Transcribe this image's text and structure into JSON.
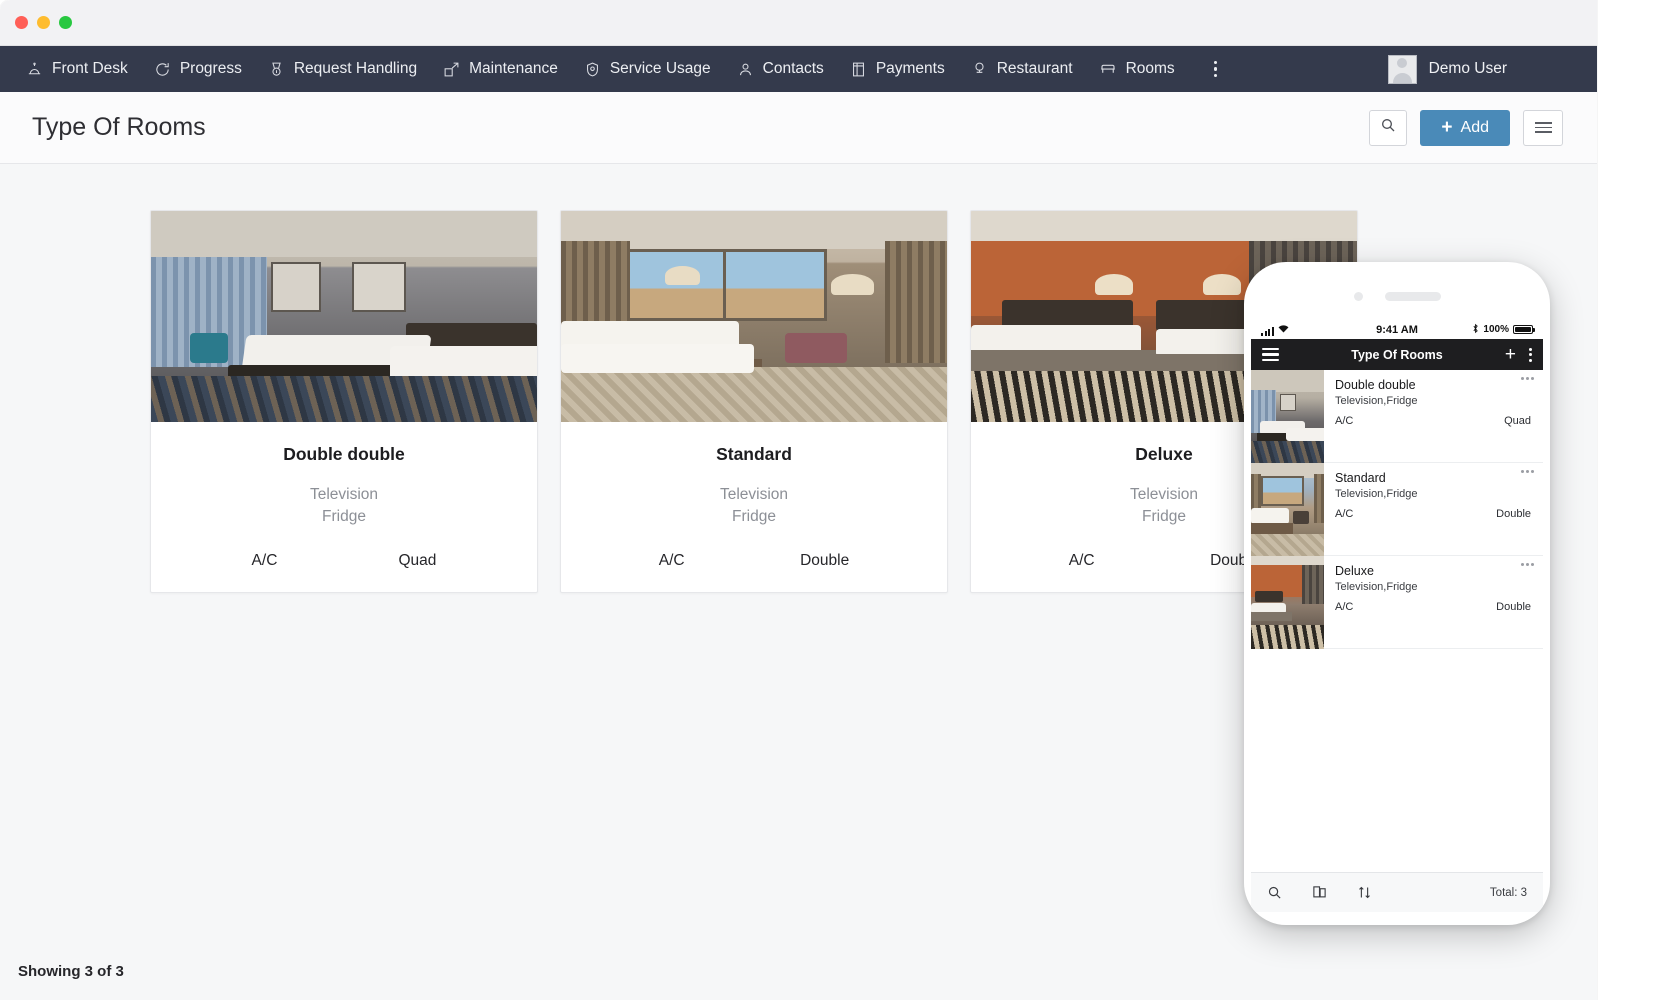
{
  "window": {
    "traffic_lights": [
      "close",
      "minimize",
      "maximize"
    ]
  },
  "navbar": {
    "items": [
      {
        "label": "Front Desk",
        "icon": "bell-icon"
      },
      {
        "label": "Progress",
        "icon": "refresh-icon"
      },
      {
        "label": "Request Handling",
        "icon": "medal-icon"
      },
      {
        "label": "Maintenance",
        "icon": "expand-arrow-icon"
      },
      {
        "label": "Service Usage",
        "icon": "shield-icon"
      },
      {
        "label": "Contacts",
        "icon": "person-icon"
      },
      {
        "label": "Payments",
        "icon": "card-icon"
      },
      {
        "label": "Restaurant",
        "icon": "chef-hat-icon"
      },
      {
        "label": "Rooms",
        "icon": "bed-icon"
      }
    ],
    "overflow_icon": "vertical-dots-icon",
    "user": {
      "name": "Demo User",
      "avatar": "user-avatar-icon"
    },
    "background": "#343a4c"
  },
  "header": {
    "title": "Type Of Rooms",
    "search_icon": "search-icon",
    "add_label": "Add",
    "add_icon": "plus-icon",
    "add_color": "#4a8ab8",
    "menu_icon": "list-view-icon"
  },
  "cards": [
    {
      "name": "Double double",
      "features": [
        "Television",
        "Fridge"
      ],
      "ac": "A/C",
      "occupancy": "Quad",
      "image": "hotel-room-double-double"
    },
    {
      "name": "Standard",
      "features": [
        "Television",
        "Fridge"
      ],
      "ac": "A/C",
      "occupancy": "Double",
      "image": "hotel-room-standard"
    },
    {
      "name": "Deluxe",
      "features": [
        "Television",
        "Fridge"
      ],
      "ac": "A/C",
      "occupancy": "Double",
      "image": "hotel-room-deluxe"
    }
  ],
  "footer": {
    "showing": "Showing 3 of 3"
  },
  "phone": {
    "status_bar": {
      "time": "9:41 AM",
      "signal_icon": "signal-bars-icon",
      "wifi_icon": "wifi-icon",
      "bluetooth_icon": "bluetooth-icon",
      "battery_percent": "100%",
      "battery_icon": "battery-full-icon"
    },
    "appbar": {
      "menu_icon": "hamburger-icon",
      "title": "Type Of Rooms",
      "add_icon": "plus-icon",
      "more_icon": "vertical-dots-icon"
    },
    "rows": [
      {
        "title": "Double double",
        "subtitle": "Television,Fridge",
        "ac": "A/C",
        "occupancy": "Quad",
        "more_icon": "horizontal-dots-icon"
      },
      {
        "title": "Standard",
        "subtitle": "Television,Fridge",
        "ac": "A/C",
        "occupancy": "Double",
        "more_icon": "horizontal-dots-icon"
      },
      {
        "title": "Deluxe",
        "subtitle": "Television,Fridge",
        "ac": "A/C",
        "occupancy": "Double",
        "more_icon": "horizontal-dots-icon"
      }
    ],
    "bottom_bar": {
      "search_icon": "search-icon",
      "copy_icon": "duplicate-icon",
      "sort_icon": "sort-arrows-icon",
      "total_label": "Total: 3"
    }
  }
}
